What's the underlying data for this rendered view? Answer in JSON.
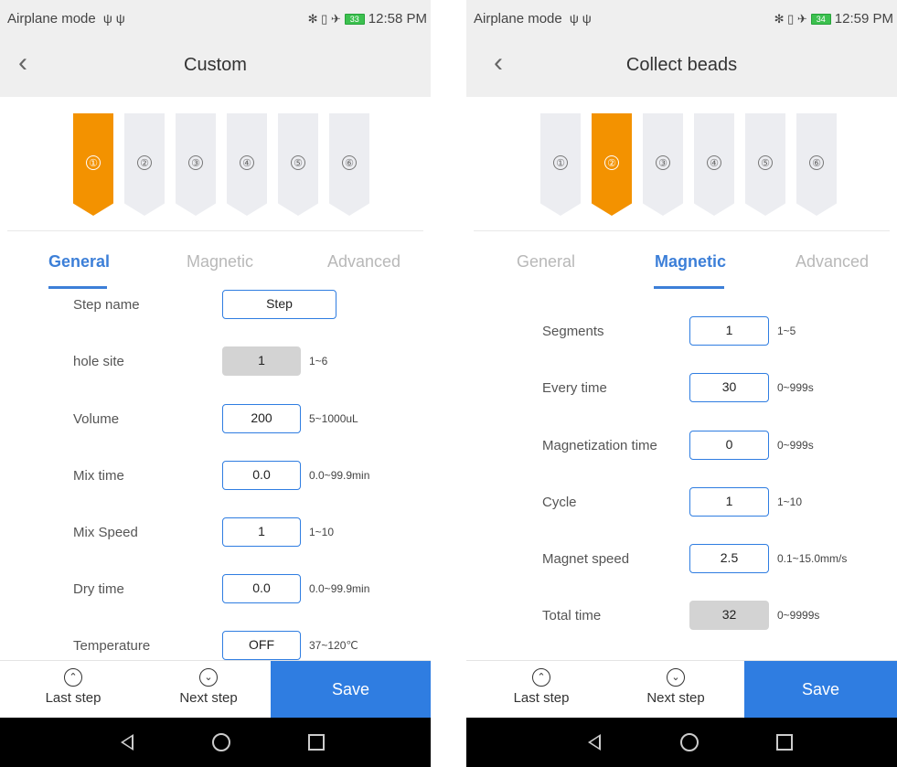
{
  "left": {
    "status": {
      "left_text": "Airplane mode",
      "usb_glyphs": "ψ ψ",
      "icons": "✻ ▯ ✈",
      "battery": "33",
      "time": "12:58 PM"
    },
    "header": {
      "back": "‹",
      "title": "Custom"
    },
    "steps": [
      "①",
      "②",
      "③",
      "④",
      "⑤",
      "⑥"
    ],
    "active_step": 1,
    "tabs": [
      "General",
      "Magnetic",
      "Advanced"
    ],
    "active_tab": "General",
    "fields": [
      {
        "label": "Step name",
        "value": "Step",
        "range": "",
        "disabled": false
      },
      {
        "label": "hole site",
        "value": "1",
        "range": "1~6",
        "disabled": true
      },
      {
        "label": "Volume",
        "value": "200",
        "range": "5~1000uL",
        "disabled": false
      },
      {
        "label": "Mix time",
        "value": "0.0",
        "range": "0.0~99.9min",
        "disabled": false
      },
      {
        "label": "Mix Speed",
        "value": "1",
        "range": "1~10",
        "disabled": false
      },
      {
        "label": "Dry time",
        "value": "0.0",
        "range": "0.0~99.9min",
        "disabled": false
      },
      {
        "label": "Temperature",
        "value": "OFF",
        "range": "37~120℃",
        "disabled": false
      }
    ],
    "bottom": {
      "last_icon": "⌃",
      "last": "Last step",
      "next_icon": "⌄",
      "next": "Next step",
      "save": "Save"
    }
  },
  "right": {
    "status": {
      "left_text": "Airplane mode",
      "usb_glyphs": "ψ ψ",
      "icons": "✻ ▯ ✈",
      "battery": "34",
      "time": "12:59 PM"
    },
    "header": {
      "back": "‹",
      "title": "Collect beads"
    },
    "steps": [
      "①",
      "②",
      "③",
      "④",
      "⑤",
      "⑥"
    ],
    "active_step": 2,
    "tabs": [
      "General",
      "Magnetic",
      "Advanced"
    ],
    "active_tab": "Magnetic",
    "fields": [
      {
        "label": "Segments",
        "value": "1",
        "range": "1~5",
        "disabled": false
      },
      {
        "label": "Every time",
        "value": "30",
        "range": "0~999s",
        "disabled": false
      },
      {
        "label": "Magnetization time",
        "value": "0",
        "range": "0~999s",
        "disabled": false
      },
      {
        "label": "Cycle",
        "value": "1",
        "range": "1~10",
        "disabled": false
      },
      {
        "label": "Magnet speed",
        "value": "2.5",
        "range": "0.1~15.0mm/s",
        "disabled": false
      },
      {
        "label": "Total time",
        "value": "32",
        "range": "0~9999s",
        "disabled": true
      }
    ],
    "bottom": {
      "last_icon": "⌃",
      "last": "Last step",
      "next_icon": "⌄",
      "next": "Next step",
      "save": "Save"
    }
  },
  "colors": {
    "accent": "#2f7de1",
    "active_step": "#f39200",
    "tab_active": "#3c7fd8",
    "disabled_field": "#d3d3d3"
  }
}
